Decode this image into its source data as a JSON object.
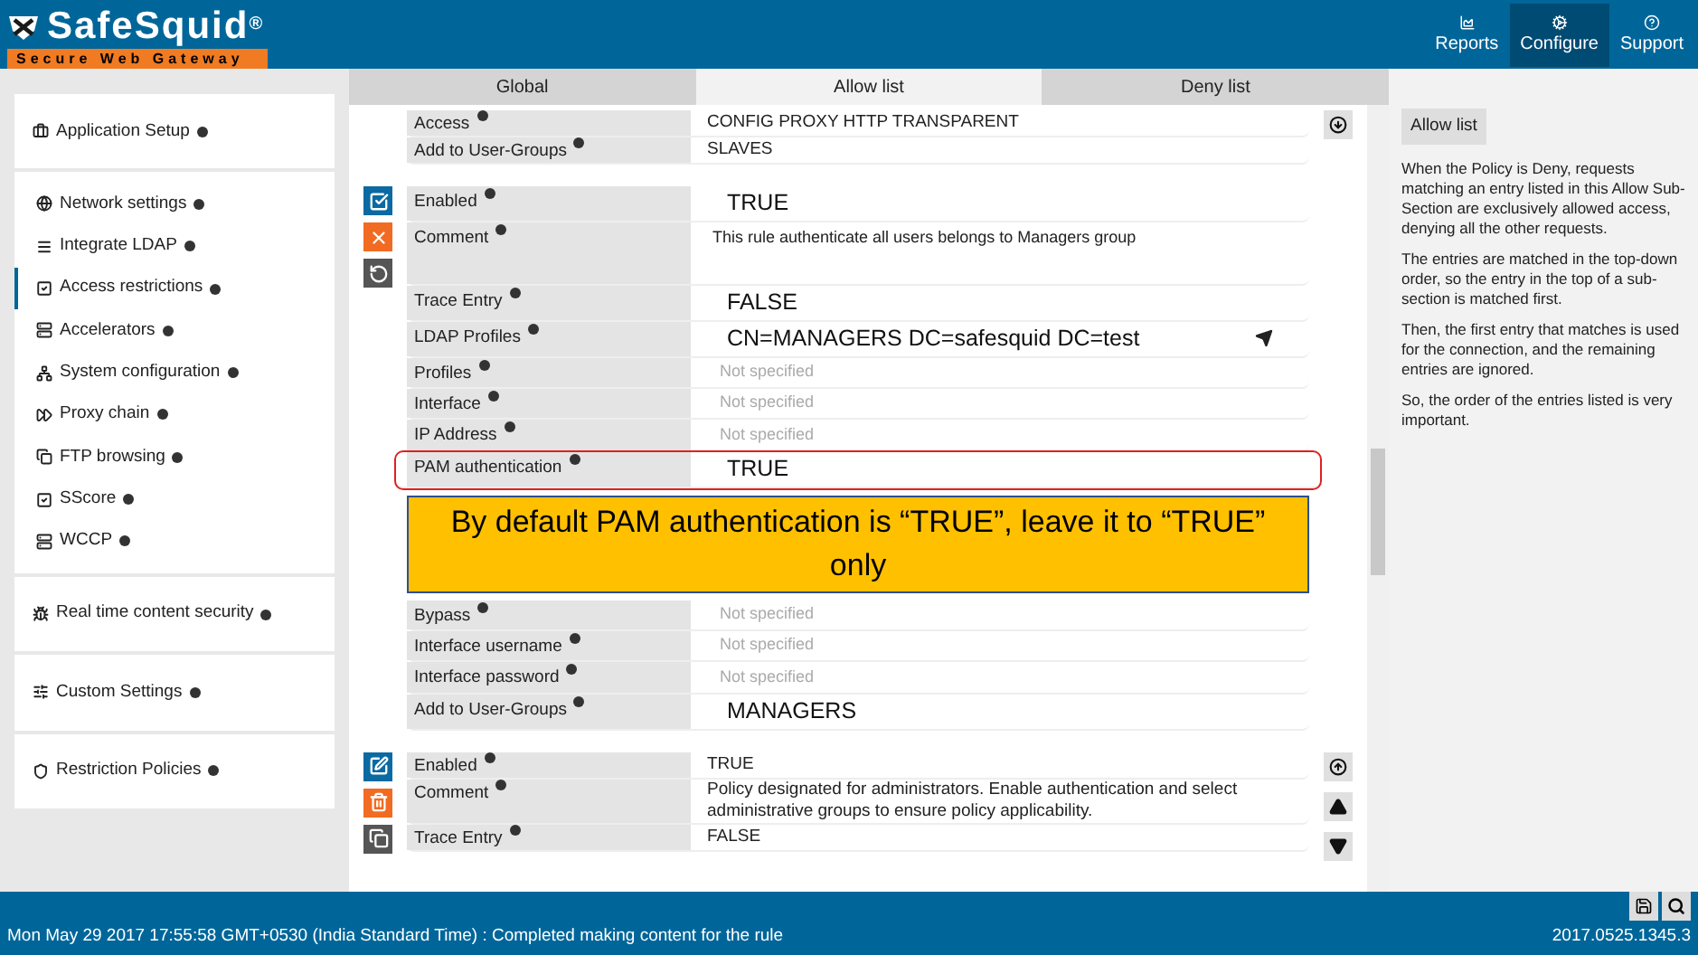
{
  "header": {
    "logo": {
      "name": "SafeSquid",
      "mark": "®",
      "tagline": "Secure Web Gateway"
    },
    "nav": [
      {
        "label": "Reports",
        "selected": false
      },
      {
        "label": "Configure",
        "selected": true
      },
      {
        "label": "Support",
        "selected": false
      }
    ]
  },
  "sidebar": {
    "groups": [
      {
        "items": [
          {
            "label": "Application Setup",
            "selected": false
          }
        ]
      },
      {
        "items": [
          {
            "label": "Network settings",
            "selected": false
          },
          {
            "label": "Integrate LDAP",
            "selected": false
          },
          {
            "label": "Access restrictions",
            "selected": true
          },
          {
            "label": "Accelerators",
            "selected": false
          },
          {
            "label": "System configuration",
            "selected": false
          },
          {
            "label": "Proxy chain",
            "selected": false
          },
          {
            "label": "FTP browsing",
            "selected": false
          },
          {
            "label": "SScore",
            "selected": false
          },
          {
            "label": "WCCP",
            "selected": false
          }
        ]
      },
      {
        "items": [
          {
            "label": "Real time content security",
            "selected": false
          }
        ]
      },
      {
        "items": [
          {
            "label": "Custom Settings",
            "selected": false
          }
        ]
      },
      {
        "items": [
          {
            "label": "Restriction Policies",
            "selected": false
          }
        ]
      }
    ]
  },
  "tabs": [
    {
      "label": "Global",
      "selected": false
    },
    {
      "label": "Allow list",
      "selected": true
    },
    {
      "label": "Deny list",
      "selected": false
    }
  ],
  "rules": [
    {
      "editing": false,
      "controls": [
        {
          "kind": "move-bottom"
        }
      ],
      "fields": [
        {
          "kind": "text",
          "label": "Access",
          "value": "CONFIG  PROXY  HTTP  TRANSPARENT",
          "highlighted": false
        },
        {
          "kind": "text",
          "label": "Add to User-Groups",
          "value": "SLAVES",
          "highlighted": false
        }
      ]
    },
    {
      "editing": true,
      "fields": [
        {
          "kind": "text",
          "label": "Enabled",
          "value": "TRUE",
          "highlighted": false
        },
        {
          "kind": "textarea",
          "label": "Comment",
          "value": "This rule authenticate all users belongs to Managers group",
          "highlighted": false
        },
        {
          "kind": "text",
          "label": "Trace Entry",
          "value": "FALSE",
          "highlighted": false
        },
        {
          "kind": "picker",
          "label": "LDAP Profiles",
          "value": "CN=MANAGERS DC=safesquid DC=test",
          "highlighted": false
        },
        {
          "kind": "text",
          "label": "Profiles",
          "placeholder": "Not specified",
          "highlighted": false
        },
        {
          "kind": "text",
          "label": "Interface",
          "placeholder": "Not specified",
          "highlighted": false
        },
        {
          "kind": "text",
          "label": "IP Address",
          "placeholder": "Not specified",
          "highlighted": false
        },
        {
          "kind": "text",
          "label": "PAM authentication",
          "value": "TRUE",
          "highlighted": true
        },
        {
          "kind": "callout",
          "text": "By default PAM authentication is “TRUE”, leave it to “TRUE” only"
        },
        {
          "kind": "text",
          "label": "Bypass",
          "placeholder": "Not specified",
          "highlighted": false
        },
        {
          "kind": "text",
          "label": "Interface username",
          "placeholder": "Not specified",
          "highlighted": false
        },
        {
          "kind": "text",
          "label": "Interface password",
          "placeholder": "Not specified",
          "highlighted": false
        },
        {
          "kind": "text",
          "label": "Add to User-Groups",
          "value": "MANAGERS",
          "highlighted": false
        }
      ]
    },
    {
      "editing": false,
      "controls": [
        {
          "kind": "move-top"
        },
        {
          "kind": "move-up"
        },
        {
          "kind": "move-down"
        }
      ],
      "fields": [
        {
          "kind": "text",
          "label": "Enabled",
          "value": "TRUE",
          "highlighted": false
        },
        {
          "kind": "text",
          "label": "Comment",
          "value": "Policy designated for administrators. Enable authentication and select administrative groups to ensure policy applicability.",
          "highlighted": false
        },
        {
          "kind": "text",
          "label": "Trace Entry",
          "value": "FALSE",
          "highlighted": false
        }
      ]
    }
  ],
  "help": {
    "title": "Allow list",
    "paragraphs": [
      "When the Policy is Deny, requests matching an entry listed in this Allow Sub-Section are exclusively allowed access, denying all the other requests.",
      "The entries are matched in the top-down order, so the entry in the top of a sub-section is matched first.",
      "Then, the first entry that matches is used for the connection, and the remaining entries are ignored.",
      "So, the order of the entries listed is very important."
    ]
  },
  "status_bar": {
    "message": "Mon May 29 2017 17:55:58 GMT+0530 (India Standard Time) : Completed making content for the rule",
    "version": "2017.0525.1345.3"
  }
}
